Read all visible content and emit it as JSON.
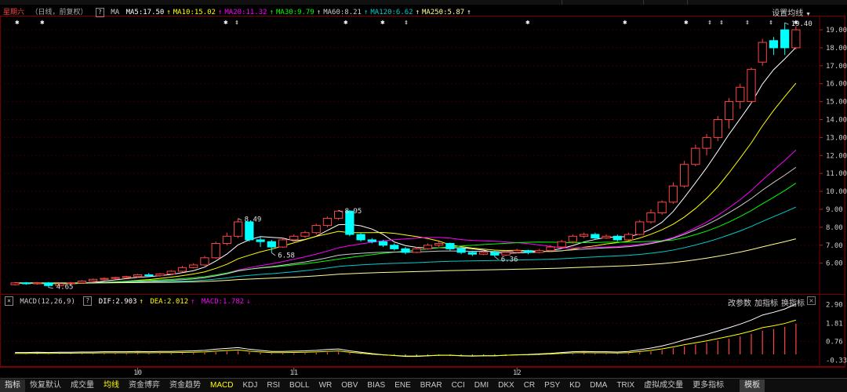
{
  "header": {
    "day": "星期六",
    "mode": "（日线，前复权）",
    "ma_label": "MA",
    "indicators": [
      {
        "label": "MA5:17.50",
        "color": "#ffffff"
      },
      {
        "label": "MA10:15.02",
        "color": "#ffff00"
      },
      {
        "label": "MA20:11.32",
        "color": "#ff00ff"
      },
      {
        "label": "MA30:9.79",
        "color": "#00ff00"
      },
      {
        "label": "MA60:8.21",
        "color": "#cccccc"
      },
      {
        "label": "MA120:6.62",
        "color": "#00cccc"
      },
      {
        "label": "MA250:5.87",
        "color": "#ffff99"
      }
    ],
    "settings_button": "设置均线"
  },
  "macd_header": {
    "name": "MACD(12,26,9)",
    "dif": "DIF:2.903",
    "dea": "DEA:2.012",
    "macd": "MACD:1.782"
  },
  "macd_buttons": [
    "改参数",
    "加指标",
    "换指标"
  ],
  "price_axis": [
    "19.00",
    "18.00",
    "17.00",
    "16.00",
    "15.00",
    "14.00",
    "13.00",
    "12.00",
    "11.00",
    "10.00",
    "9.00",
    "8.00",
    "7.00",
    "6.00"
  ],
  "macd_axis": [
    "2.90",
    "1.81",
    "0.76",
    "-0.33"
  ],
  "month_labels": [
    "10",
    "11",
    "12"
  ],
  "annotations": [
    "19.40",
    "8.49",
    "8.95",
    "6.58",
    "6.36",
    "4.65"
  ],
  "tabs": [
    "指标",
    "恢复默认",
    "成交量",
    "均线",
    "资金博弈",
    "资金趋势",
    "MACD",
    "KDJ",
    "RSI",
    "BOLL",
    "WR",
    "OBV",
    "BIAS",
    "ENE",
    "BRAR",
    "CCI",
    "DMI",
    "DKX",
    "CR",
    "PSY",
    "KD",
    "DMA",
    "TRIX",
    "虚拟成交量",
    "更多指标",
    "模板"
  ],
  "highlight_tabs": [
    "均线",
    "MACD"
  ],
  "colors": {
    "up": "#ff4444",
    "down": "#00ffff",
    "bg": "#000000",
    "grid": "#3a0000"
  },
  "chart_data": {
    "type": "candlestick",
    "price_ylim": [
      4.5,
      19.7
    ],
    "macd_ylim": [
      -0.45,
      3.1
    ],
    "candles": [
      [
        4.8,
        4.9,
        4.75,
        4.95
      ],
      [
        4.9,
        4.85,
        4.8,
        4.95
      ],
      [
        4.85,
        4.9,
        4.8,
        4.95
      ],
      [
        4.9,
        4.75,
        4.65,
        4.95
      ],
      [
        4.75,
        4.85,
        4.7,
        4.9
      ],
      [
        4.85,
        4.9,
        4.8,
        4.95
      ],
      [
        4.9,
        5.0,
        4.85,
        5.05
      ],
      [
        5.0,
        5.1,
        4.95,
        5.15
      ],
      [
        5.1,
        5.15,
        5.05,
        5.2
      ],
      [
        5.15,
        5.2,
        5.1,
        5.25
      ],
      [
        5.2,
        5.25,
        5.15,
        5.3
      ],
      [
        5.25,
        5.35,
        5.2,
        5.4
      ],
      [
        5.35,
        5.3,
        5.25,
        5.45
      ],
      [
        5.3,
        5.4,
        5.25,
        5.45
      ],
      [
        5.4,
        5.55,
        5.35,
        5.6
      ],
      [
        5.55,
        5.75,
        5.5,
        5.85
      ],
      [
        5.75,
        5.9,
        5.7,
        6.0
      ],
      [
        5.9,
        6.3,
        5.85,
        6.4
      ],
      [
        6.3,
        7.1,
        6.25,
        7.2
      ],
      [
        7.1,
        7.5,
        7.0,
        7.7
      ],
      [
        7.5,
        8.3,
        7.4,
        8.49
      ],
      [
        8.3,
        7.3,
        7.2,
        8.3
      ],
      [
        7.3,
        7.2,
        6.9,
        7.5
      ],
      [
        7.2,
        6.9,
        6.58,
        7.3
      ],
      [
        6.9,
        7.3,
        6.85,
        7.4
      ],
      [
        7.3,
        7.5,
        7.2,
        7.6
      ],
      [
        7.5,
        7.7,
        7.4,
        7.8
      ],
      [
        7.7,
        8.1,
        7.6,
        8.2
      ],
      [
        8.1,
        8.5,
        8.0,
        8.6
      ],
      [
        8.5,
        8.9,
        8.4,
        8.95
      ],
      [
        8.9,
        7.6,
        7.5,
        8.95
      ],
      [
        7.6,
        7.3,
        7.2,
        7.7
      ],
      [
        7.3,
        7.2,
        7.1,
        7.4
      ],
      [
        7.2,
        7.0,
        6.9,
        7.3
      ],
      [
        7.0,
        6.8,
        6.7,
        7.1
      ],
      [
        6.8,
        6.6,
        6.5,
        6.9
      ],
      [
        6.6,
        6.8,
        6.55,
        6.9
      ],
      [
        6.8,
        7.0,
        6.75,
        7.1
      ],
      [
        7.0,
        7.1,
        6.9,
        7.2
      ],
      [
        7.1,
        6.8,
        6.7,
        7.15
      ],
      [
        6.8,
        6.6,
        6.5,
        6.9
      ],
      [
        6.6,
        6.5,
        6.4,
        6.7
      ],
      [
        6.5,
        6.6,
        6.45,
        6.7
      ],
      [
        6.6,
        6.45,
        6.36,
        6.7
      ],
      [
        6.45,
        6.6,
        6.4,
        6.7
      ],
      [
        6.6,
        6.7,
        6.55,
        6.8
      ],
      [
        6.7,
        6.6,
        6.5,
        6.75
      ],
      [
        6.6,
        6.7,
        6.55,
        6.8
      ],
      [
        6.7,
        6.9,
        6.65,
        7.0
      ],
      [
        6.9,
        7.2,
        6.85,
        7.3
      ],
      [
        7.2,
        7.5,
        7.1,
        7.6
      ],
      [
        7.5,
        7.6,
        7.4,
        7.7
      ],
      [
        7.6,
        7.4,
        7.3,
        7.7
      ],
      [
        7.4,
        7.5,
        7.35,
        7.6
      ],
      [
        7.5,
        7.3,
        7.2,
        7.6
      ],
      [
        7.3,
        7.6,
        7.25,
        7.7
      ],
      [
        7.6,
        8.3,
        7.55,
        8.4
      ],
      [
        8.3,
        8.8,
        8.2,
        9.0
      ],
      [
        8.8,
        9.4,
        8.7,
        9.5
      ],
      [
        9.4,
        10.3,
        9.3,
        10.5
      ],
      [
        10.3,
        11.5,
        10.2,
        11.7
      ],
      [
        11.5,
        12.4,
        11.4,
        12.6
      ],
      [
        12.4,
        13.0,
        12.0,
        13.2
      ],
      [
        13.0,
        14.0,
        12.8,
        14.2
      ],
      [
        14.0,
        15.0,
        13.5,
        15.2
      ],
      [
        15.0,
        15.8,
        14.6,
        16.0
      ],
      [
        15.0,
        16.8,
        14.9,
        16.9
      ],
      [
        17.2,
        18.3,
        17.0,
        18.5
      ],
      [
        18.4,
        18.0,
        17.6,
        18.6
      ],
      [
        19.0,
        18.0,
        17.6,
        19.4
      ],
      [
        18.0,
        19.0,
        17.9,
        19.2
      ]
    ],
    "macd_bars": [
      0.02,
      0.02,
      0.03,
      0.02,
      0.03,
      0.03,
      0.04,
      0.04,
      0.05,
      0.05,
      0.05,
      0.06,
      0.05,
      0.06,
      0.06,
      0.07,
      0.08,
      0.1,
      0.14,
      0.17,
      0.2,
      0.14,
      0.1,
      0.06,
      0.06,
      0.07,
      0.08,
      0.1,
      0.13,
      0.15,
      0.08,
      0.03,
      -0.02,
      -0.06,
      -0.09,
      -0.12,
      -0.12,
      -0.1,
      -0.08,
      -0.08,
      -0.1,
      -0.11,
      -0.1,
      -0.1,
      -0.08,
      -0.06,
      -0.05,
      -0.03,
      -0.01,
      0.02,
      0.05,
      0.06,
      0.05,
      0.05,
      0.04,
      0.06,
      0.12,
      0.18,
      0.26,
      0.36,
      0.48,
      0.58,
      0.68,
      0.8,
      0.92,
      1.05,
      1.2,
      1.38,
      1.48,
      1.6,
      1.78
    ]
  }
}
